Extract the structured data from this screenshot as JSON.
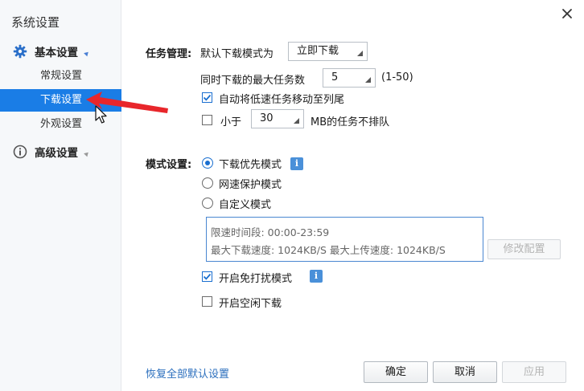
{
  "sidebar": {
    "title": "系统设置",
    "groups": [
      {
        "label": "基本设置",
        "icon": "gear-icon",
        "expanded": true,
        "items": [
          {
            "label": "常规设置"
          },
          {
            "label": "下载设置",
            "active": true
          },
          {
            "label": "外观设置"
          }
        ]
      },
      {
        "label": "高级设置",
        "icon": "info-circle-icon",
        "expanded": false
      }
    ]
  },
  "task": {
    "section_label": "任务管理:",
    "default_mode_label": "默认下载模式为",
    "default_mode_value": "立即下载",
    "max_tasks_label": "同时下载的最大任务数",
    "max_tasks_value": "5",
    "max_tasks_range": "(1-50)",
    "auto_move_label": "自动将低速任务移动至列尾",
    "auto_move_checked": true,
    "less_than_label": "小于",
    "less_than_value": "30",
    "less_than_suffix": "MB的任务不排队",
    "less_than_checked": false
  },
  "mode": {
    "section_label": "模式设置:",
    "options": [
      {
        "label": "下载优先模式",
        "selected": true
      },
      {
        "label": "网速保护模式",
        "selected": false
      },
      {
        "label": "自定义模式",
        "selected": false
      }
    ],
    "schedule_line1": "限速时间段:  00:00-23:59",
    "schedule_line2": "最大下载速度:  1024KB/S   最大上传速度:  1024KB/S",
    "modify_button": "修改配置",
    "no_disturb_label": "开启免打扰模式",
    "no_disturb_checked": true,
    "idle_download_label": "开启空闲下载",
    "idle_download_checked": false
  },
  "footer": {
    "restore_link": "恢复全部默认设置",
    "ok_button": "确定",
    "cancel_button": "取消",
    "apply_button": "应用"
  },
  "colors": {
    "accent": "#1a7de6",
    "link": "#2a6ebd",
    "annotation_arrow": "#e8262b"
  }
}
